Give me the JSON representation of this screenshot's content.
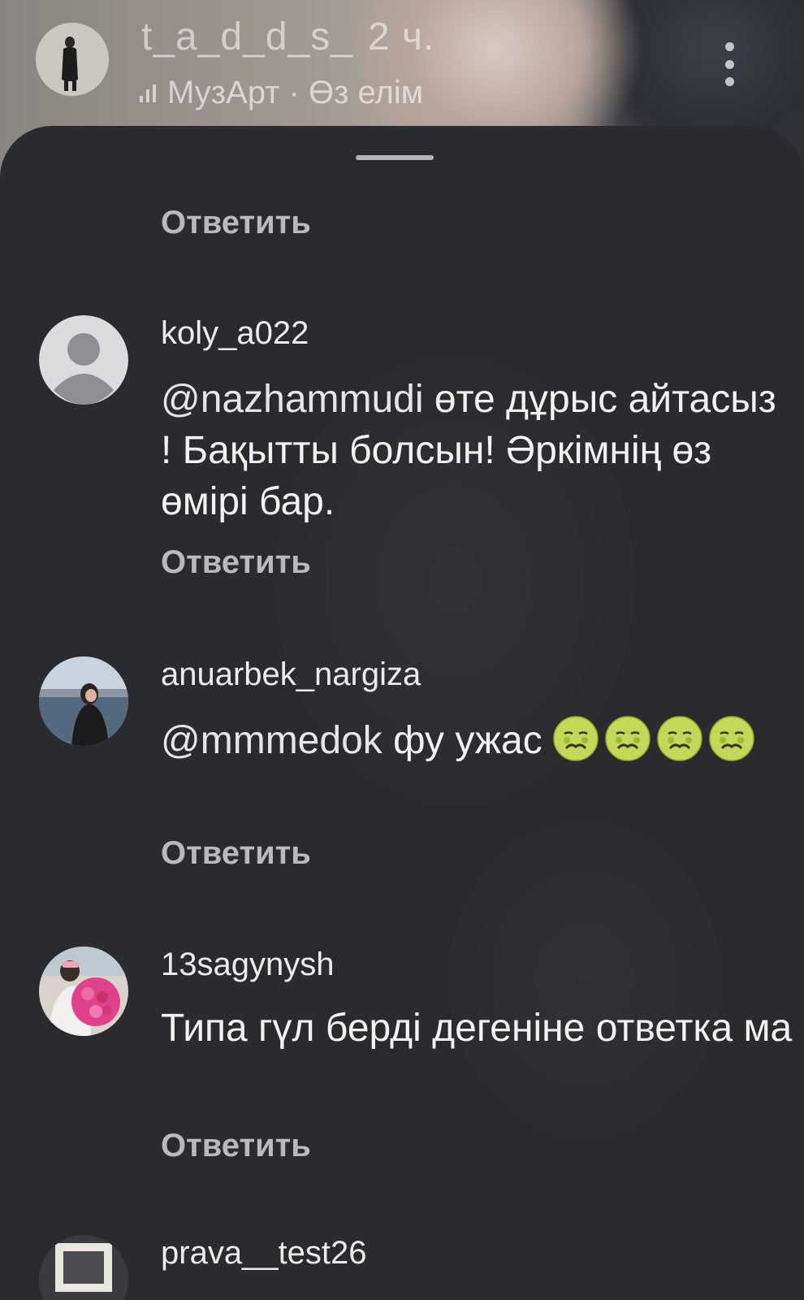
{
  "story": {
    "username": "t_a_d_d_s_",
    "time": "2 ч.",
    "music": "МузАрт · Өз елім"
  },
  "sheet": {
    "top_reply": "Ответить",
    "comments": [
      {
        "username": "koly_a022",
        "mention": "@nazhammudi",
        "text": " өте дұрыс айтасыз !  Бақытты болсын! Әркімнің өз өмірі бар.",
        "reply": "Ответить"
      },
      {
        "username": "anuarbek_nargiza",
        "mention": "@mmmedok",
        "text": " фу ужас",
        "emoji": "🥴🥴🥴🥴",
        "reply": "Ответить"
      },
      {
        "username": "13sagynysh",
        "text": "Типа гүл берді дегеніне ответка ма",
        "reply": "Ответить"
      },
      {
        "username": "prava__test26"
      }
    ]
  },
  "icons": {
    "more": "more-vertical-icon",
    "music": "music-bars-icon",
    "emoji": "nauseated-face-emoji"
  }
}
